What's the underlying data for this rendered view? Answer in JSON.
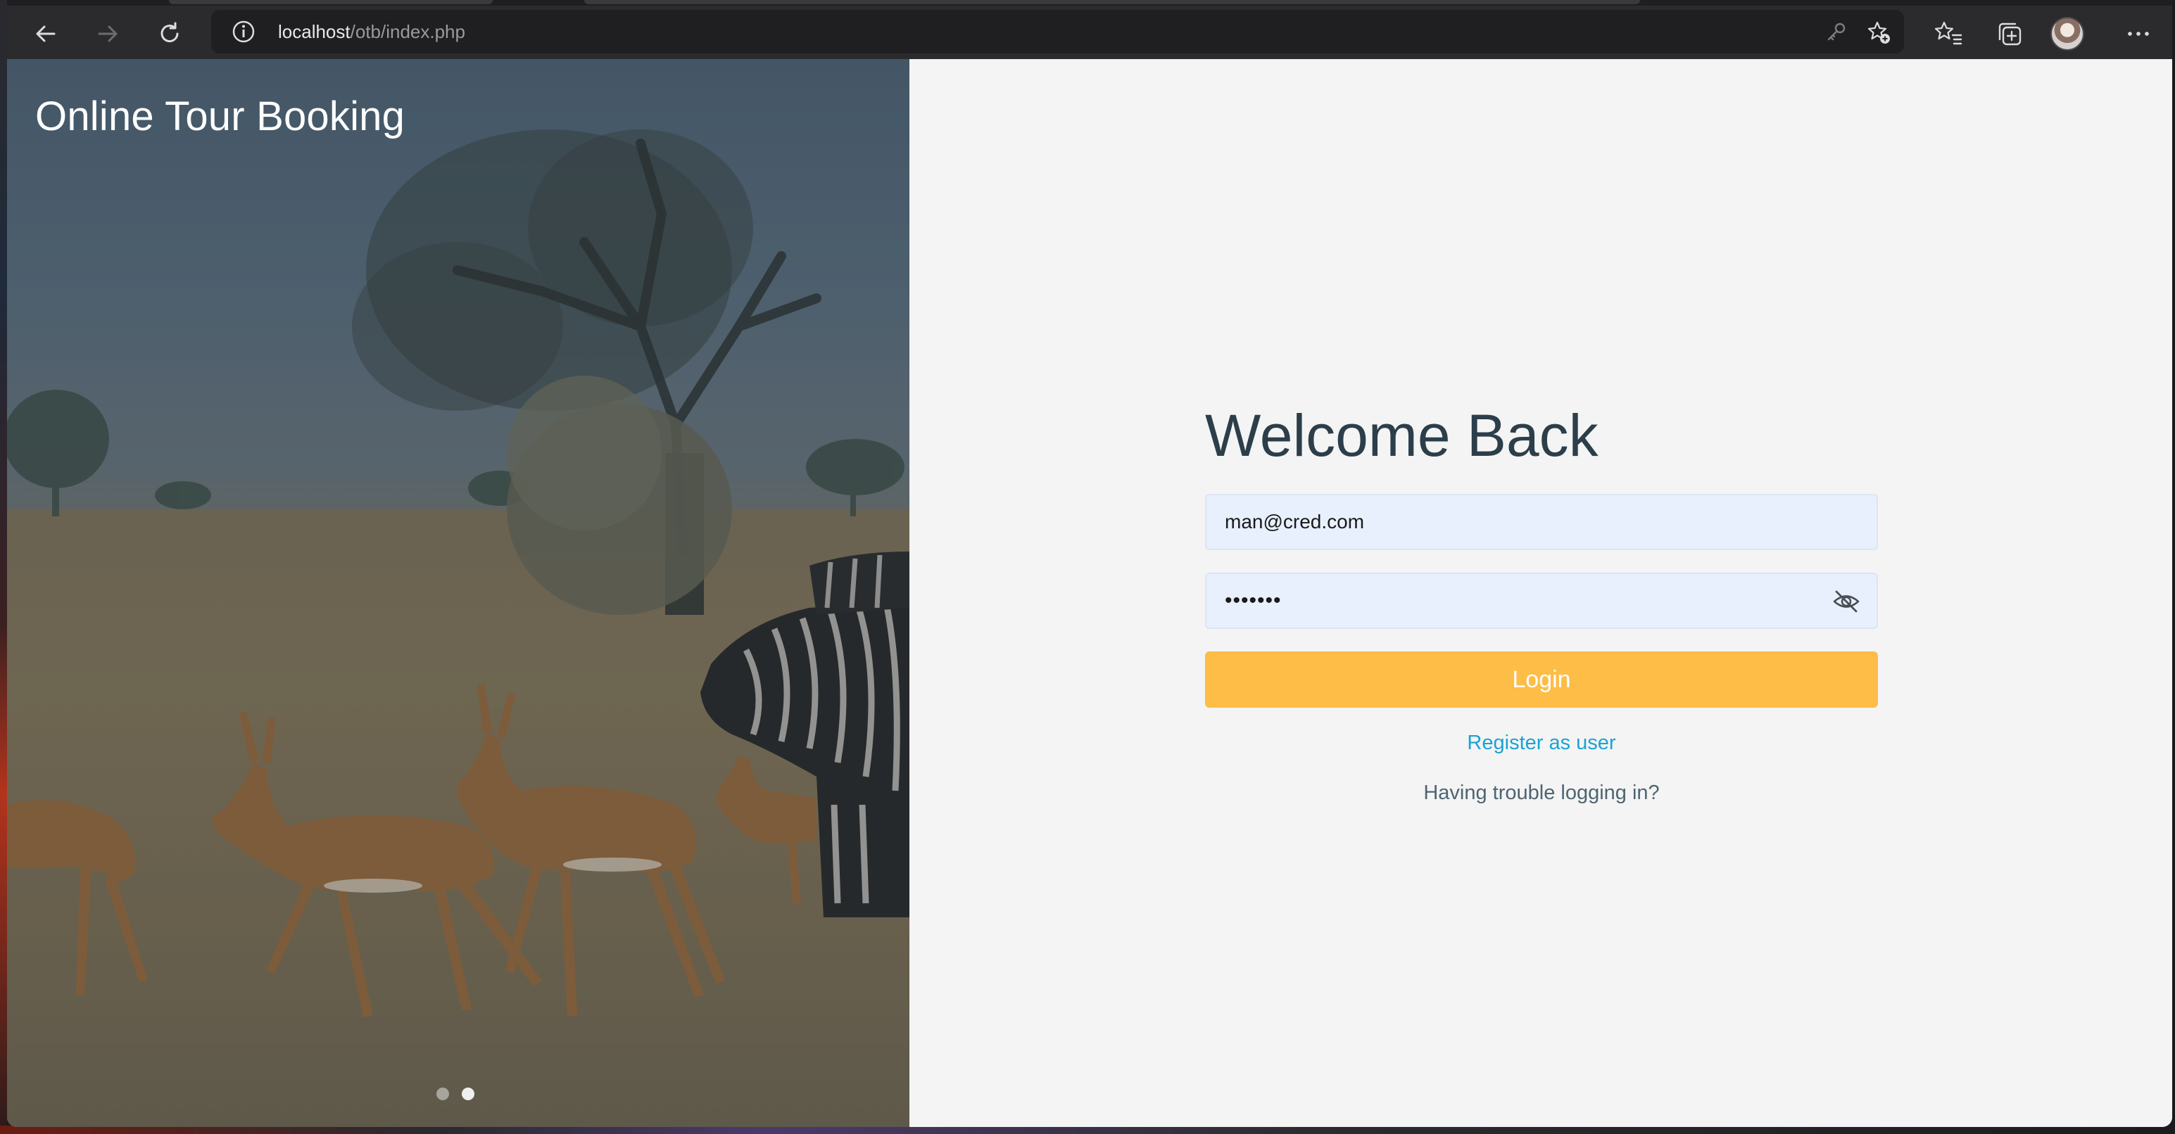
{
  "browser": {
    "url_host": "localhost",
    "url_path": "/otb/index.php"
  },
  "page": {
    "brand": "Online Tour Booking",
    "heading": "Welcome Back",
    "email_value": "man@cred.com",
    "password_masked": "•••••••",
    "login_label": "Login",
    "register_link": "Register as user",
    "trouble_link": "Having trouble logging in?",
    "carousel": {
      "slides": 2,
      "active_index": 1
    }
  },
  "colors": {
    "accent_button": "#fdbd47",
    "link": "#1aa3d4",
    "heading": "#2c3e4a",
    "input_bg": "#e8f0fd"
  },
  "icons": {
    "back": "back-arrow-icon",
    "forward": "forward-arrow-icon",
    "reload": "reload-icon",
    "site_info": "info-icon",
    "password_key": "key-icon",
    "add_favorite": "star-plus-icon",
    "favorites": "favorites-list-icon",
    "collections": "collections-icon",
    "menu": "more-icon",
    "toggle_password": "eye-off-icon"
  }
}
